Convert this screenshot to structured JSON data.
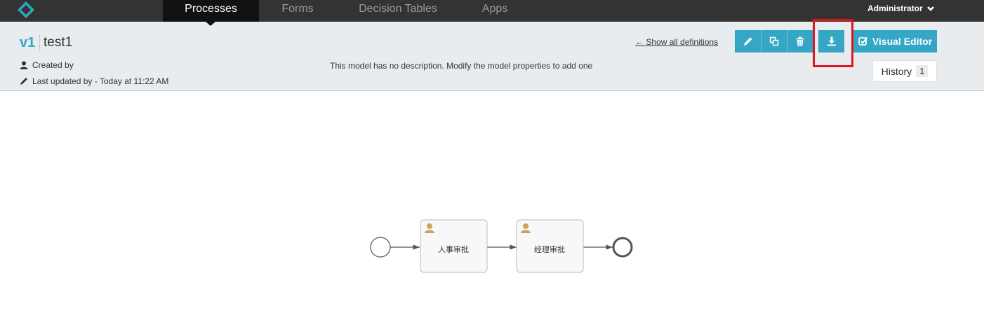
{
  "nav": {
    "tabs": [
      {
        "label": "Processes",
        "active": true
      },
      {
        "label": "Forms",
        "active": false
      },
      {
        "label": "Decision Tables",
        "active": false
      },
      {
        "label": "Apps",
        "active": false
      }
    ],
    "user": "Administrator"
  },
  "model": {
    "version": "v1",
    "name": "test1",
    "created_by": "Created by",
    "last_updated": "Last updated by - Today at 11:22 AM",
    "description": "This model has no description. Modify the model properties to add one"
  },
  "actions": {
    "show_all": "Show all definitions",
    "visual_editor": "Visual Editor",
    "history_label": "History",
    "history_count": "1"
  },
  "diagram": {
    "tasks": [
      {
        "label": "人事审批"
      },
      {
        "label": "经理审批"
      }
    ]
  },
  "colors": {
    "accent": "#34a7c7",
    "navbar": "#333333",
    "header_bg": "#e8ecef",
    "highlight": "#e0161e",
    "user_task_icon": "#c9a45c"
  }
}
